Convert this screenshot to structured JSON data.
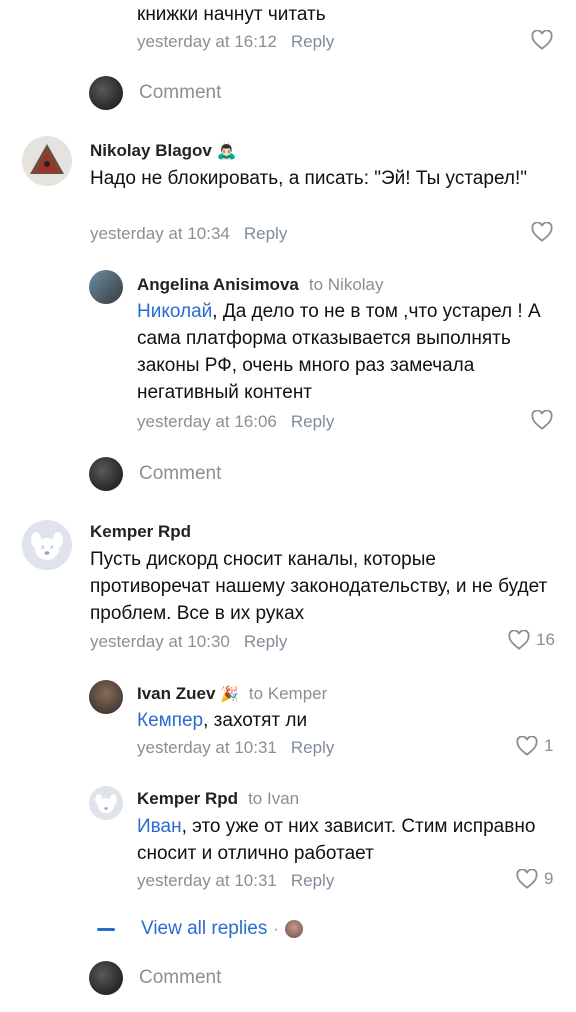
{
  "top_comment": {
    "text_tail": "книжки начнут читать",
    "time": "yesterday at 16:12",
    "reply_label": "Reply"
  },
  "comment_prompt": "Comment",
  "thread1": {
    "author": "Nikolay Blagov",
    "author_emoji": "🙇🏻‍♂️",
    "text": "Надо не блокировать, а писать: \"Эй! Ты устарел!\"",
    "time": "yesterday at 10:34",
    "reply_label": "Reply",
    "replies": [
      {
        "author": "Angelina Anisimova",
        "to": "to Nikolay",
        "mention": "Николай",
        "text": ", Да дело то не в том ,что устарел ! А сама платформа отказывается выполнять законы РФ, очень много раз замечала негативный контент",
        "time": "yesterday at 16:06",
        "reply_label": "Reply"
      }
    ]
  },
  "thread2": {
    "author": "Kemper Rpd",
    "text": "Пусть дискорд сносит каналы, которые противоречат нашему законодательству, и не будет проблем. Все в их руках",
    "time": "yesterday at 10:30",
    "reply_label": "Reply",
    "likes": "16",
    "replies": [
      {
        "author": "Ivan Zuev",
        "author_emoji": "🎉",
        "to": "to Kemper",
        "mention": "Кемпер",
        "text": ", захотят ли",
        "time": "yesterday at 10:31",
        "reply_label": "Reply",
        "likes": "1"
      },
      {
        "author": "Kemper Rpd",
        "to": "to Ivan",
        "mention": "Иван",
        "text": ", это уже от них зависит. Стим исправно сносит и отлично работает",
        "time": "yesterday at 10:31",
        "reply_label": "Reply",
        "likes": "9"
      }
    ],
    "view_all_label": "View all replies",
    "view_all_separator": "·"
  },
  "colors": {
    "link": "#2a6bd1",
    "meta": "#8a8f96",
    "text": "#111111"
  },
  "icons": [
    "heart-icon",
    "avatar",
    "dash-icon"
  ]
}
